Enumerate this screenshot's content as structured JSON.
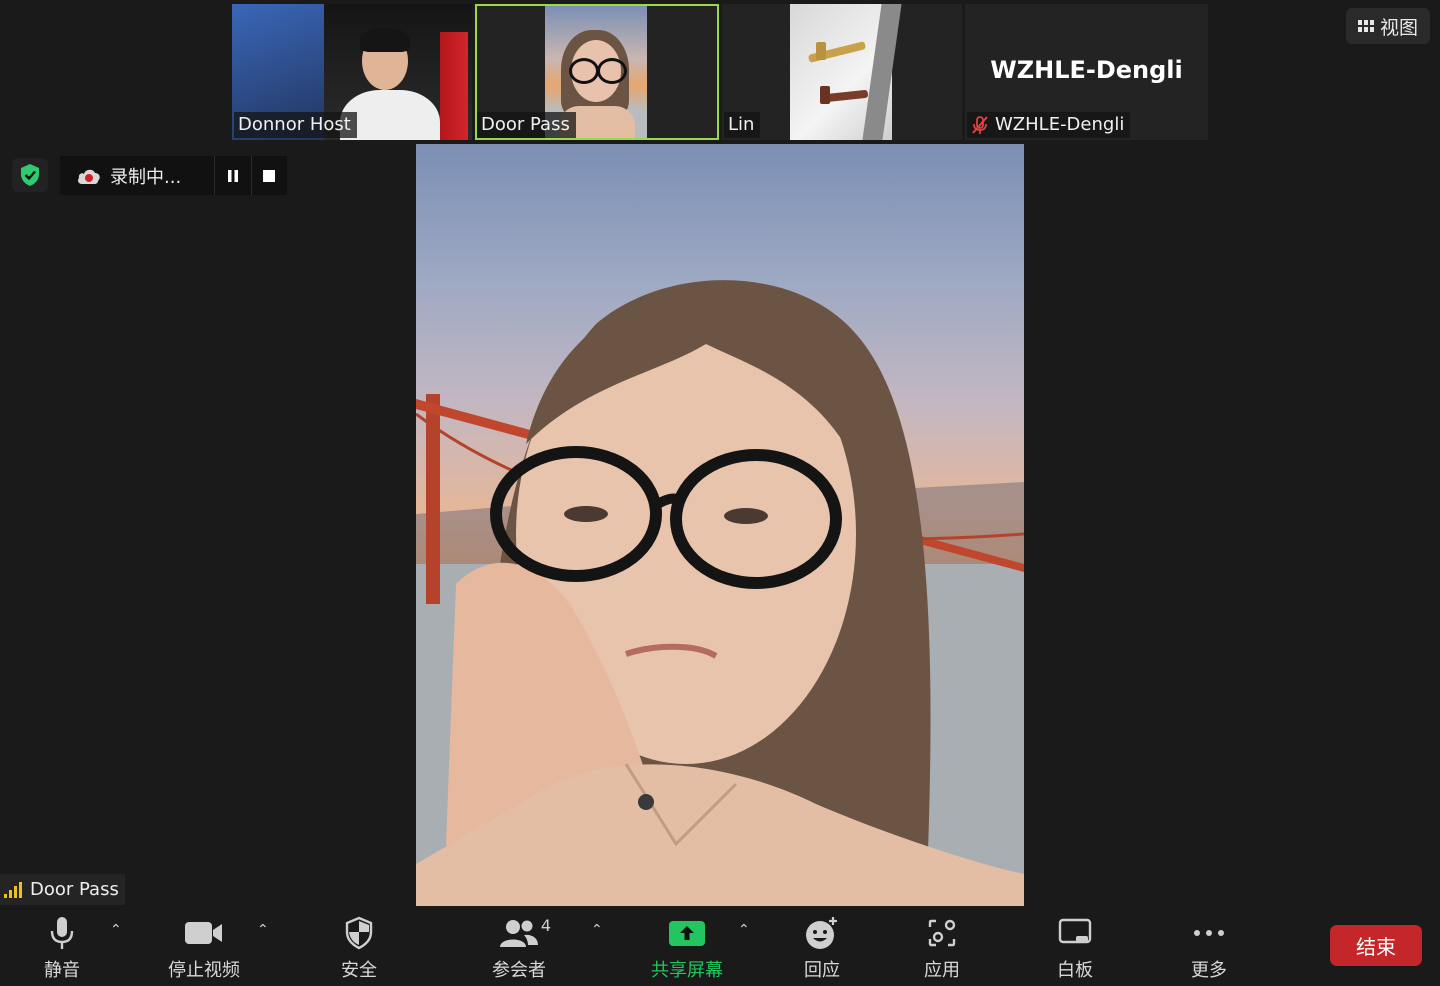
{
  "top": {
    "view_label": "视图"
  },
  "thumbnails": [
    {
      "name": "Donnor Host"
    },
    {
      "name": "Door Pass"
    },
    {
      "name": "Lin"
    },
    {
      "name": "WZHLE-Dengli",
      "big_name": "WZHLE-Dengli",
      "muted": true
    }
  ],
  "recording": {
    "label": "录制中..."
  },
  "active_speaker": {
    "name": "Door Pass"
  },
  "toolbar": {
    "mute": "静音",
    "stop_video": "停止视频",
    "security": "安全",
    "participants": "参会者",
    "participants_count": "4",
    "share_screen": "共享屏幕",
    "reactions": "回应",
    "apps": "应用",
    "whiteboard": "白板",
    "more": "更多",
    "end": "结束"
  },
  "colors": {
    "active_outline": "#9ad845",
    "share_green": "#22c55e",
    "end_red": "#c4262a",
    "shield_green": "#2ecc71"
  }
}
